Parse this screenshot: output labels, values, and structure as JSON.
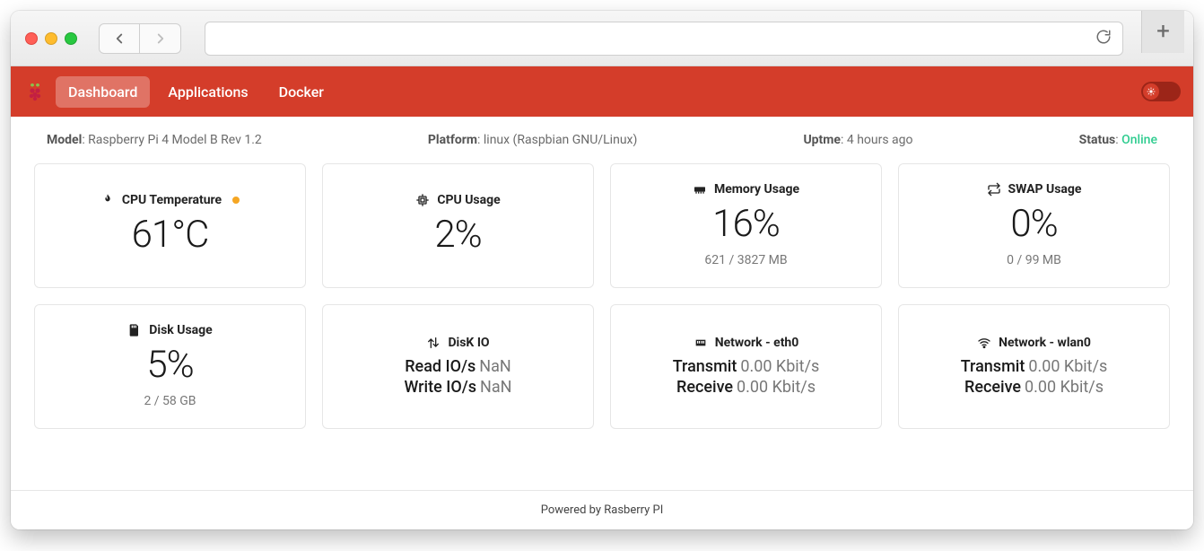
{
  "nav": {
    "tabs": [
      "Dashboard",
      "Applications",
      "Docker"
    ],
    "active_index": 0
  },
  "info": {
    "model_label": "Model",
    "model_value": ": Raspberry Pi 4 Model B Rev 1.2",
    "platform_label": "Platform",
    "platform_value": ": linux (Raspbian GNU/Linux)",
    "uptime_label": "Uptme",
    "uptime_value": ": 4 hours ago",
    "status_label": "Status",
    "status_value": "Online"
  },
  "cards": {
    "cpu_temp": {
      "title": "CPU Temperature",
      "value": "61°C",
      "warn": true
    },
    "cpu_usage": {
      "title": "CPU Usage",
      "value": "2%"
    },
    "memory": {
      "title": "Memory Usage",
      "value": "16%",
      "sub": "621 / 3827 MB"
    },
    "swap": {
      "title": "SWAP Usage",
      "value": "0%",
      "sub": "0 / 99 MB"
    },
    "disk": {
      "title": "Disk Usage",
      "value": "5%",
      "sub": "2 / 58 GB"
    },
    "diskio": {
      "title": "DisK IO",
      "read_label": "Read IO/s",
      "read_value": "NaN",
      "write_label": "Write IO/s",
      "write_value": "NaN"
    },
    "eth0": {
      "title": "Network - eth0",
      "tx_label": "Transmit",
      "tx_value": "0.00 Kbit/s",
      "rx_label": "Receive",
      "rx_value": "0.00 Kbit/s"
    },
    "wlan0": {
      "title": "Network - wlan0",
      "tx_label": "Transmit",
      "tx_value": "0.00 Kbit/s",
      "rx_label": "Receive",
      "rx_value": "0.00 Kbit/s"
    }
  },
  "footer": "Powered by Rasberry PI"
}
